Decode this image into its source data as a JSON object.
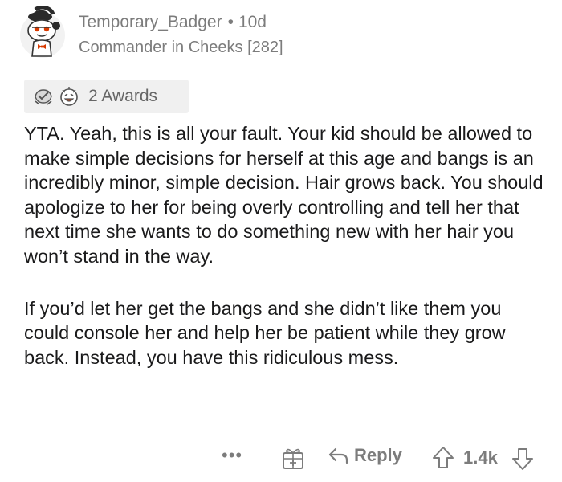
{
  "comment": {
    "author": "Temporary_Badger",
    "separator": "•",
    "age": "10d",
    "flair": "Commander in Cheeks [282]",
    "awards": {
      "count_label": "2 Awards",
      "icons": [
        "wholesome-seal-award-icon",
        "laughing-face-award-icon"
      ]
    },
    "body": [
      "YTA. Yeah, this is all your fault. Your kid should be allowed to make simple decisions for herself at this age and bangs is an incredibly minor, simple decision. Hair grows back. You should apologize to her for being overly controlling and tell her that next time she wants to do something new with her hair you won’t stand in the way.",
      "If you’d let her get the bangs and she didn’t like them you could console her and help her be patient while they grow back. Instead, you have this ridiculous mess."
    ],
    "actions": {
      "more_label": "•••",
      "reply_label": "Reply",
      "score": "1.4k"
    }
  },
  "colors": {
    "meta_text": "#7c7c7c",
    "body_text": "#1a1a1b",
    "awards_bg": "#f0f0f0",
    "avatar_red": "#d93a00"
  }
}
